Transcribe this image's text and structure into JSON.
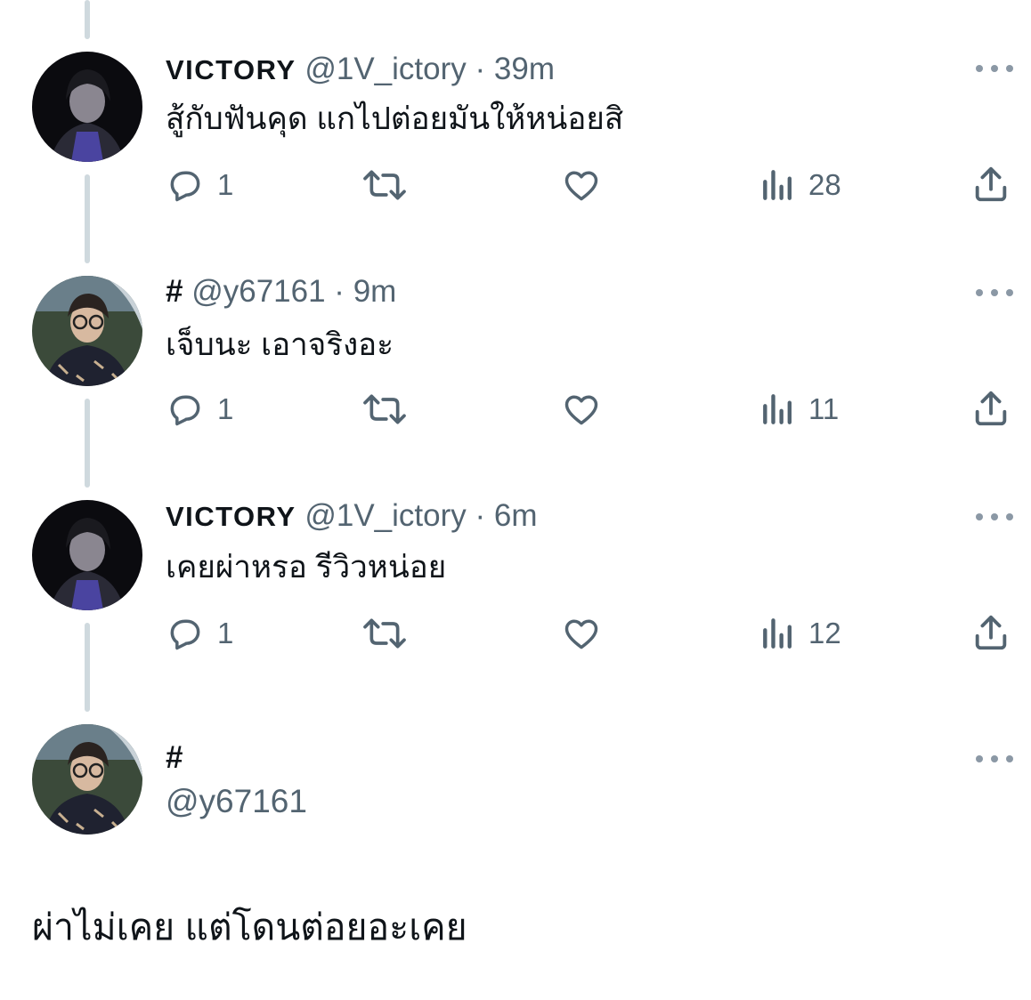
{
  "tweets": [
    {
      "name": "VICTORY",
      "handle": "@1V_ictory",
      "sep": "·",
      "time": "39m",
      "text": "สู้กับฟันคุด แกไปต่อยมันให้หน่อยสิ",
      "replies": "1",
      "views": "28"
    },
    {
      "name": "#",
      "handle": "@y67161",
      "sep": "·",
      "time": "9m",
      "text": "เจ็บนะ เอาจริงอะ",
      "replies": "1",
      "views": "11"
    },
    {
      "name": "VICTORY",
      "handle": "@1V_ictory",
      "sep": "·",
      "time": "6m",
      "text": "เคยผ่าหรอ รีวิวหน่อย",
      "replies": "1",
      "views": "12"
    }
  ],
  "main": {
    "name": "#",
    "handle": "@y67161",
    "text": "ผ่าไม่เคย แต่โดนต่อยอะเคย"
  },
  "icons": {
    "reply": "reply-icon",
    "retweet": "retweet-icon",
    "like": "heart-icon",
    "views": "views-icon",
    "share": "share-icon",
    "more": "more-icon"
  },
  "colors": {
    "secondary": "#536471",
    "thread_line": "#cfd9de"
  }
}
